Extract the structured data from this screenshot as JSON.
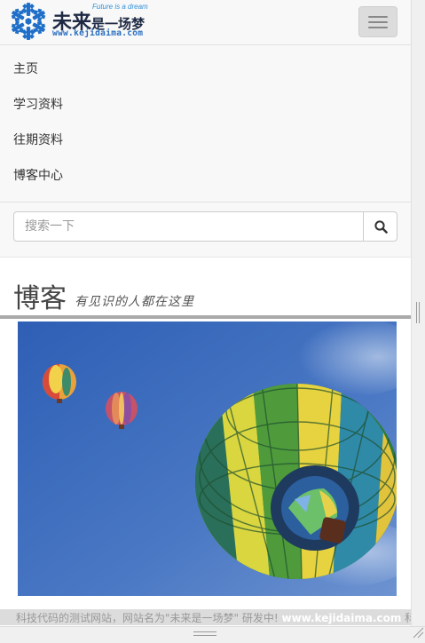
{
  "brand": {
    "name_large": "未来",
    "name_small": "是一场梦",
    "slogan": "Future is a dream",
    "url": "www.kejidaima.com",
    "logo_icon": "snowflake-icon",
    "color": "#2a6fc0"
  },
  "navbar": {
    "toggle_icon": "hamburger-menu-icon",
    "items": [
      {
        "label": "主页"
      },
      {
        "label": "学习资料"
      },
      {
        "label": "往期资料"
      },
      {
        "label": "博客中心"
      }
    ]
  },
  "search": {
    "placeholder": "搜索一下",
    "value": "",
    "button_icon": "search-icon"
  },
  "header": {
    "title": "博客",
    "subtitle": "有见识的人都在这里"
  },
  "hero": {
    "image_subject": "hot-air-balloons-in-blue-sky"
  },
  "footer_teaser": {
    "text_before": "科技代码的测试网站，网站名为\"未来是一场梦\" 研发中!",
    "url": "www.kejidaima.com",
    "text_after": "科技"
  }
}
